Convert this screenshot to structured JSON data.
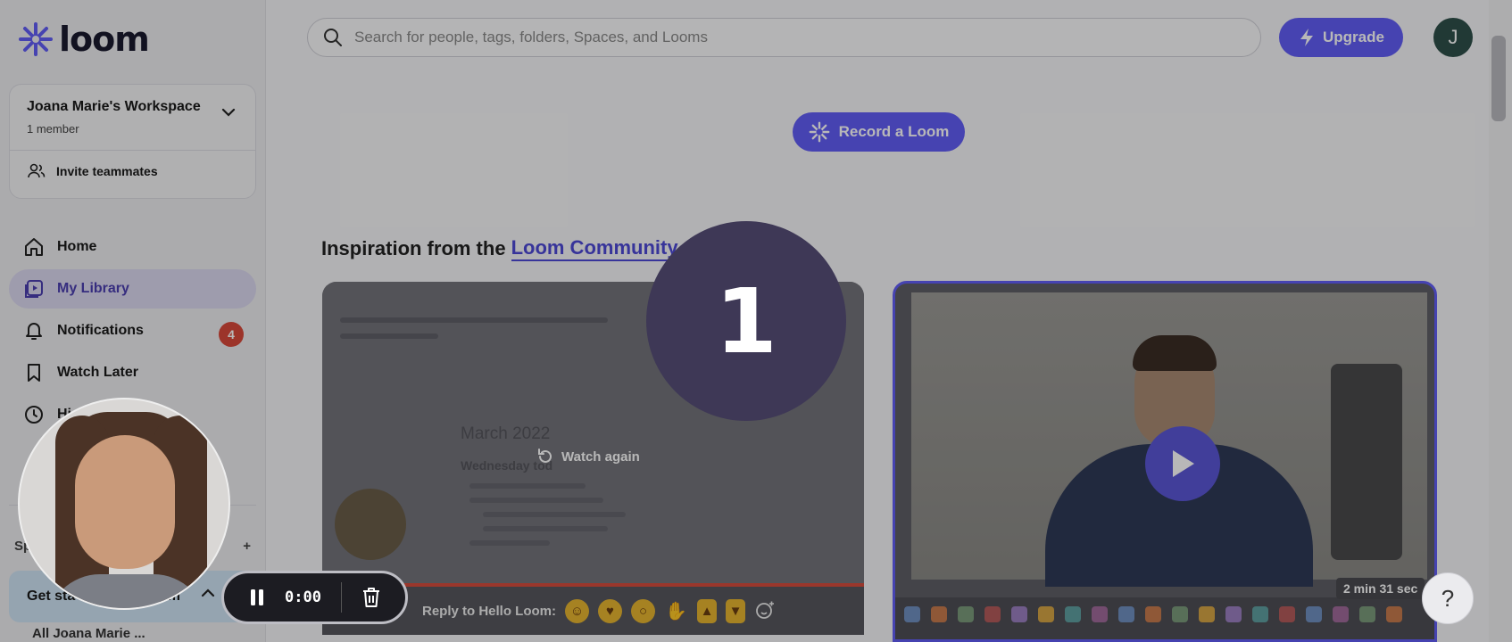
{
  "brand": {
    "logo_text": "loom"
  },
  "workspace": {
    "name": "Joana Marie's Workspace",
    "members": "1 member",
    "invite_label": "Invite teammates"
  },
  "nav": {
    "home": "Home",
    "library": "My Library",
    "notifications": "Notifications",
    "notifications_count": "4",
    "watch_later": "Watch Later",
    "history_partial": "Hi"
  },
  "spaces": {
    "label_partial": "Sp"
  },
  "get_started": {
    "label": "Get sta",
    "label_tail": "om"
  },
  "all_workspace": "All Joana Marie ...",
  "search": {
    "placeholder": "Search for people, tags, folders, Spaces, and Looms"
  },
  "header": {
    "upgrade_label": "Upgrade",
    "avatar_initial": "J"
  },
  "record_button": "Record a Loom",
  "inspiration": {
    "prefix": "Inspiration from the",
    "link": "Loom Community"
  },
  "video1": {
    "doc_title": "March 2022",
    "doc_subtitle": "Wednesday tod",
    "watch_again": "Watch again",
    "reply_label": "Reply to Hello Loom:"
  },
  "video2": {
    "duration": "2 min 31 sec"
  },
  "countdown": "1",
  "recorder": {
    "time": "0:00"
  },
  "help": "?",
  "colors": {
    "accent": "#625df5",
    "badge": "#d9483b",
    "countdown_bg": "#3e3856"
  }
}
